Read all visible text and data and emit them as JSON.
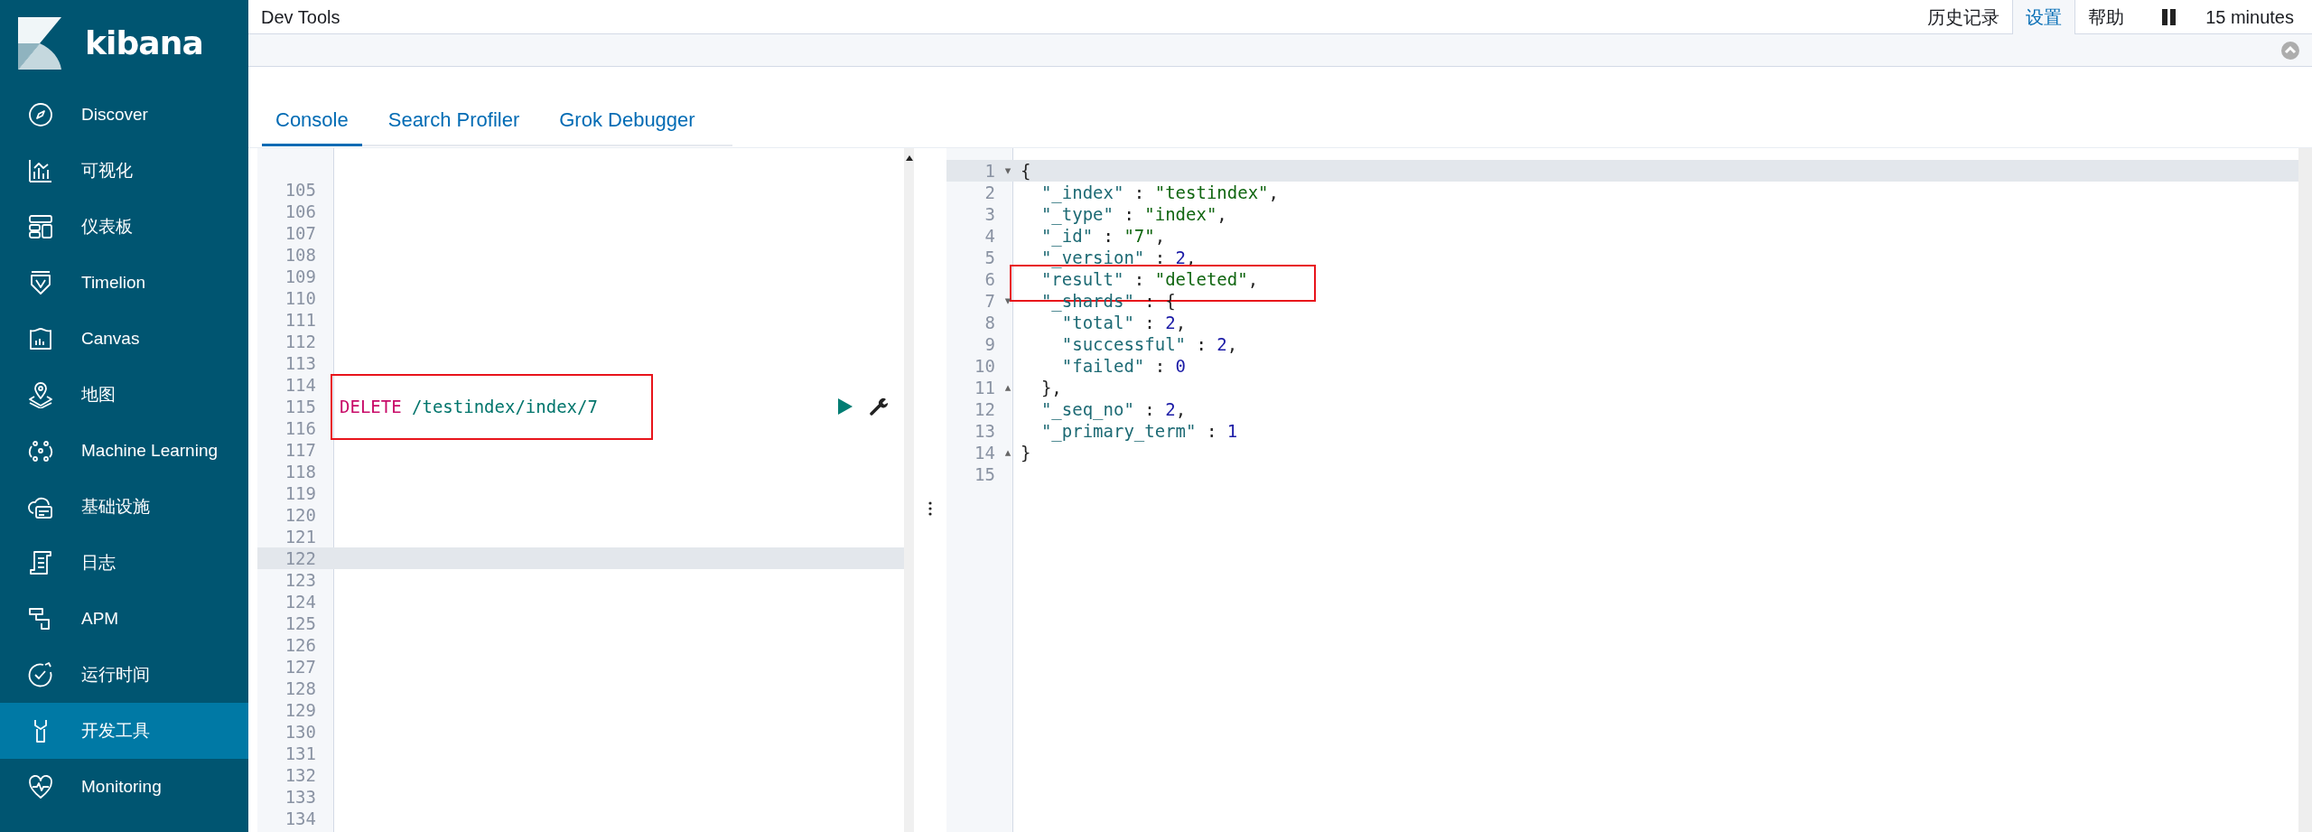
{
  "app": {
    "name": "kibana"
  },
  "sidebar": {
    "items": [
      {
        "label": "Discover",
        "selected": false
      },
      {
        "label": "可视化",
        "selected": false
      },
      {
        "label": "仪表板",
        "selected": false
      },
      {
        "label": "Timelion",
        "selected": false
      },
      {
        "label": "Canvas",
        "selected": false
      },
      {
        "label": "地图",
        "selected": false
      },
      {
        "label": "Machine Learning",
        "selected": false
      },
      {
        "label": "基础设施",
        "selected": false
      },
      {
        "label": "日志",
        "selected": false
      },
      {
        "label": "APM",
        "selected": false
      },
      {
        "label": "运行时间",
        "selected": false
      },
      {
        "label": "开发工具",
        "selected": true
      },
      {
        "label": "Monitoring",
        "selected": false
      }
    ]
  },
  "header": {
    "title": "Dev Tools",
    "links": [
      {
        "label": "历史记录",
        "selected": false
      },
      {
        "label": "设置",
        "selected": true
      },
      {
        "label": "帮助",
        "selected": false
      }
    ],
    "time_range": "15 minutes"
  },
  "tabs": [
    {
      "label": "Console",
      "selected": true
    },
    {
      "label": "Search Profiler",
      "selected": false
    },
    {
      "label": "Grok Debugger",
      "selected": false
    }
  ],
  "request_editor": {
    "lines": [
      {
        "number": "105",
        "active": false,
        "boxed": false
      },
      {
        "number": "106",
        "active": false,
        "boxed": false
      },
      {
        "number": "107",
        "active": false,
        "boxed": false
      },
      {
        "number": "108",
        "active": false,
        "boxed": false
      },
      {
        "number": "109",
        "active": false,
        "boxed": false
      },
      {
        "number": "110",
        "active": false,
        "boxed": false
      },
      {
        "number": "111",
        "active": false,
        "boxed": false
      },
      {
        "number": "112",
        "active": false,
        "boxed": false
      },
      {
        "number": "113",
        "active": false,
        "boxed": false
      },
      {
        "number": "114",
        "active": false,
        "boxed": false
      },
      {
        "number": "115",
        "active": false,
        "boxed": true,
        "actions": true,
        "tokens": [
          {
            "kind": "method",
            "text": "DELETE"
          },
          {
            "kind": "url",
            "text": "/testindex/index/7"
          }
        ]
      },
      {
        "number": "116",
        "active": false,
        "boxed": false
      },
      {
        "number": "117",
        "active": false,
        "boxed": false
      },
      {
        "number": "118",
        "active": false,
        "boxed": false
      },
      {
        "number": "119",
        "active": false,
        "boxed": false
      },
      {
        "number": "120",
        "active": false,
        "boxed": false
      },
      {
        "number": "121",
        "active": false,
        "boxed": false
      },
      {
        "number": "122",
        "active": true,
        "boxed": false
      },
      {
        "number": "123",
        "active": false,
        "boxed": false
      },
      {
        "number": "124",
        "active": false,
        "boxed": false
      },
      {
        "number": "125",
        "active": false,
        "boxed": false
      },
      {
        "number": "126",
        "active": false,
        "boxed": false
      },
      {
        "number": "127",
        "active": false,
        "boxed": false
      },
      {
        "number": "128",
        "active": false,
        "boxed": false
      },
      {
        "number": "129",
        "active": false,
        "boxed": false
      },
      {
        "number": "130",
        "active": false,
        "boxed": false
      },
      {
        "number": "131",
        "active": false,
        "boxed": false
      },
      {
        "number": "132",
        "active": false,
        "boxed": false
      },
      {
        "number": "133",
        "active": false,
        "boxed": false
      },
      {
        "number": "134",
        "active": false,
        "boxed": false
      }
    ]
  },
  "response_viewer": {
    "lines": [
      {
        "number": "1",
        "active": true,
        "boxed": false,
        "fold": "▾",
        "tokens": [
          {
            "kind": "punct",
            "text": "{"
          }
        ]
      },
      {
        "number": "2",
        "active": false,
        "boxed": false,
        "tokens": [
          {
            "kind": "key",
            "text": "  \"_index\""
          },
          {
            "kind": "punct",
            "text": " : "
          },
          {
            "kind": "string",
            "text": "\"testindex\""
          },
          {
            "kind": "punct",
            "text": ","
          }
        ]
      },
      {
        "number": "3",
        "active": false,
        "boxed": false,
        "tokens": [
          {
            "kind": "key",
            "text": "  \"_type\""
          },
          {
            "kind": "punct",
            "text": " : "
          },
          {
            "kind": "string",
            "text": "\"index\""
          },
          {
            "kind": "punct",
            "text": ","
          }
        ]
      },
      {
        "number": "4",
        "active": false,
        "boxed": false,
        "tokens": [
          {
            "kind": "key",
            "text": "  \"_id\""
          },
          {
            "kind": "punct",
            "text": " : "
          },
          {
            "kind": "string",
            "text": "\"7\""
          },
          {
            "kind": "punct",
            "text": ","
          }
        ]
      },
      {
        "number": "5",
        "active": false,
        "boxed": false,
        "tokens": [
          {
            "kind": "key",
            "text": "  \"_version\""
          },
          {
            "kind": "punct",
            "text": " : "
          },
          {
            "kind": "number",
            "text": "2"
          },
          {
            "kind": "punct",
            "text": ","
          }
        ]
      },
      {
        "number": "6",
        "active": false,
        "boxed": true,
        "tokens": [
          {
            "kind": "key",
            "text": "  \"result\""
          },
          {
            "kind": "punct",
            "text": " : "
          },
          {
            "kind": "string",
            "text": "\"deleted\""
          },
          {
            "kind": "punct",
            "text": ","
          }
        ]
      },
      {
        "number": "7",
        "active": false,
        "boxed": false,
        "fold": "▾",
        "tokens": [
          {
            "kind": "key",
            "text": "  \"_shards\""
          },
          {
            "kind": "punct",
            "text": " : {"
          }
        ]
      },
      {
        "number": "8",
        "active": false,
        "boxed": false,
        "tokens": [
          {
            "kind": "key",
            "text": "    \"total\""
          },
          {
            "kind": "punct",
            "text": " : "
          },
          {
            "kind": "number",
            "text": "2"
          },
          {
            "kind": "punct",
            "text": ","
          }
        ]
      },
      {
        "number": "9",
        "active": false,
        "boxed": false,
        "tokens": [
          {
            "kind": "key",
            "text": "    \"successful\""
          },
          {
            "kind": "punct",
            "text": " : "
          },
          {
            "kind": "number",
            "text": "2"
          },
          {
            "kind": "punct",
            "text": ","
          }
        ]
      },
      {
        "number": "10",
        "active": false,
        "boxed": false,
        "tokens": [
          {
            "kind": "key",
            "text": "    \"failed\""
          },
          {
            "kind": "punct",
            "text": " : "
          },
          {
            "kind": "number",
            "text": "0"
          }
        ]
      },
      {
        "number": "11",
        "active": false,
        "boxed": false,
        "fold": "▴",
        "tokens": [
          {
            "kind": "punct",
            "text": "  },"
          }
        ]
      },
      {
        "number": "12",
        "active": false,
        "boxed": false,
        "tokens": [
          {
            "kind": "key",
            "text": "  \"_seq_no\""
          },
          {
            "kind": "punct",
            "text": " : "
          },
          {
            "kind": "number",
            "text": "2"
          },
          {
            "kind": "punct",
            "text": ","
          }
        ]
      },
      {
        "number": "13",
        "active": false,
        "boxed": false,
        "tokens": [
          {
            "kind": "key",
            "text": "  \"_primary_term\""
          },
          {
            "kind": "punct",
            "text": " : "
          },
          {
            "kind": "number",
            "text": "1"
          }
        ]
      },
      {
        "number": "14",
        "active": false,
        "boxed": false,
        "fold": "▴",
        "tokens": [
          {
            "kind": "punct",
            "text": "}"
          }
        ]
      },
      {
        "number": "15",
        "active": false,
        "boxed": false
      }
    ]
  }
}
